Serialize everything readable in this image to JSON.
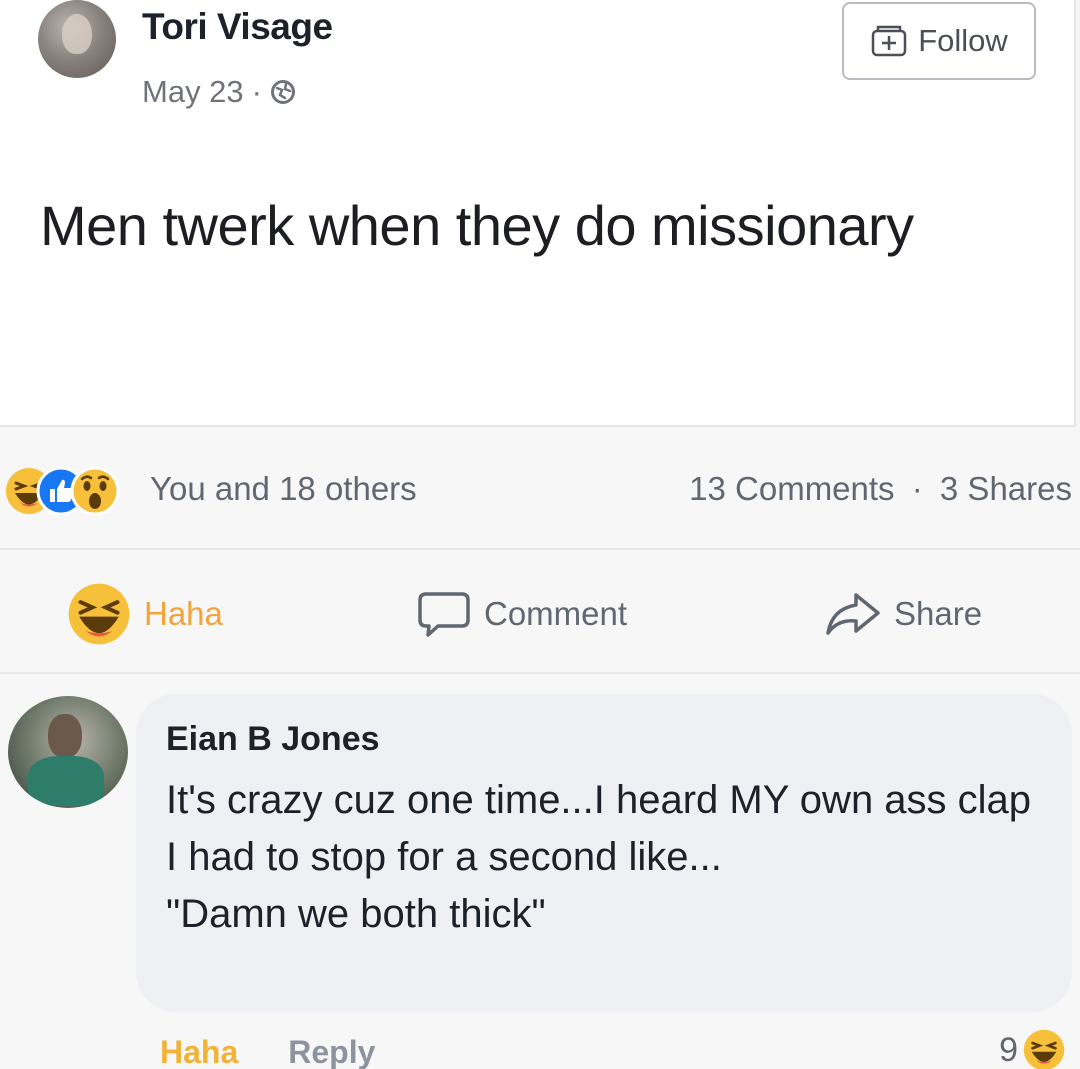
{
  "post": {
    "author": "Tori Visage",
    "date": "May 23",
    "separator": "·",
    "follow_label": "Follow",
    "text": "Men twerk when they do missionary"
  },
  "stats": {
    "reactions_text": "You and 18 others",
    "comments": "13 Comments",
    "dot": "·",
    "shares": "3 Shares"
  },
  "actions": {
    "haha": "Haha",
    "comment": "Comment",
    "share": "Share"
  },
  "comment": {
    "author": "Eian B Jones",
    "text": "It's crazy cuz one time...I heard MY own ass clap\nI had to stop for a second like...\n\"Damn we both thick\"",
    "haha_label": "Haha",
    "reply_label": "Reply",
    "reaction_count": "9"
  },
  "colors": {
    "haha_yellow": "#f7c03a",
    "like_blue": "#1877f2",
    "muted_text": "#616770"
  }
}
